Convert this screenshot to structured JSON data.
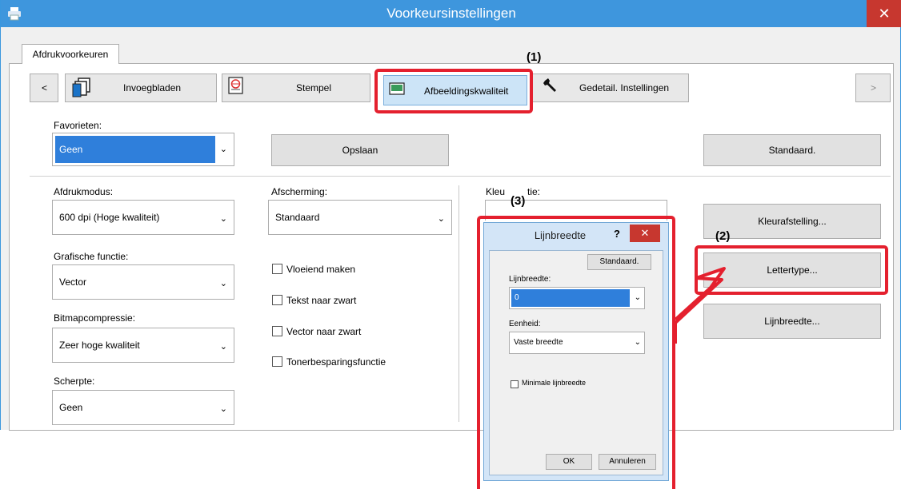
{
  "window": {
    "title": "Voorkeursinstellingen",
    "close_glyph": "✕",
    "accent": "#3e96dd"
  },
  "tab": {
    "label": "Afdrukvoorkeuren"
  },
  "nav": {
    "prev_label": "<",
    "next_label": ">",
    "items": [
      {
        "label": "Invoegbladen",
        "icon": "pages-icon"
      },
      {
        "label": "Stempel",
        "icon": "stamp-icon"
      },
      {
        "label": "Afbeeldingskwaliteit",
        "icon": "image-icon"
      },
      {
        "label": "Gedetail. Instellingen",
        "icon": "wrench-icon"
      }
    ]
  },
  "favorites": {
    "label": "Favorieten:",
    "value": "Geen",
    "save_label": "Opslaan",
    "default_label": "Standaard."
  },
  "print_mode": {
    "label": "Afdrukmodus:",
    "value": "600 dpi (Hoge kwaliteit)"
  },
  "graphic_function": {
    "label": "Grafische functie:",
    "value": "Vector"
  },
  "bitmap_compression": {
    "label": "Bitmapcompressie:",
    "value": "Zeer hoge kwaliteit"
  },
  "sharpness": {
    "label": "Scherpte:",
    "value": "Geen"
  },
  "screening": {
    "label": "Afscherming:",
    "value": "Standaard"
  },
  "checkboxes": [
    "Vloeiend maken",
    "Tekst naar zwart",
    "Vector naar zwart",
    "Tonerbesparingsfunctie"
  ],
  "color_function": {
    "label_part1": "Kleu",
    "label_part2": "tie:"
  },
  "right_buttons": {
    "color_adjust": "Kleurafstelling...",
    "font": "Lettertype...",
    "line_width": "Lijnbreedte..."
  },
  "callouts": {
    "c1": "(1)",
    "c2": "(2)",
    "c3": "(3)"
  },
  "dialog": {
    "title": "Lijnbreedte",
    "help": "?",
    "close": "✕",
    "default_label": "Standaard.",
    "width_label": "Lijnbreedte:",
    "width_value": "0",
    "unit_label": "Eenheid:",
    "unit_value": "Vaste breedte",
    "min_label": "Minimale lijnbreedte",
    "ok": "OK",
    "cancel": "Annuleren"
  },
  "colors": {
    "highlight_red": "#e4202e",
    "select_blue": "#2f7fdb"
  }
}
